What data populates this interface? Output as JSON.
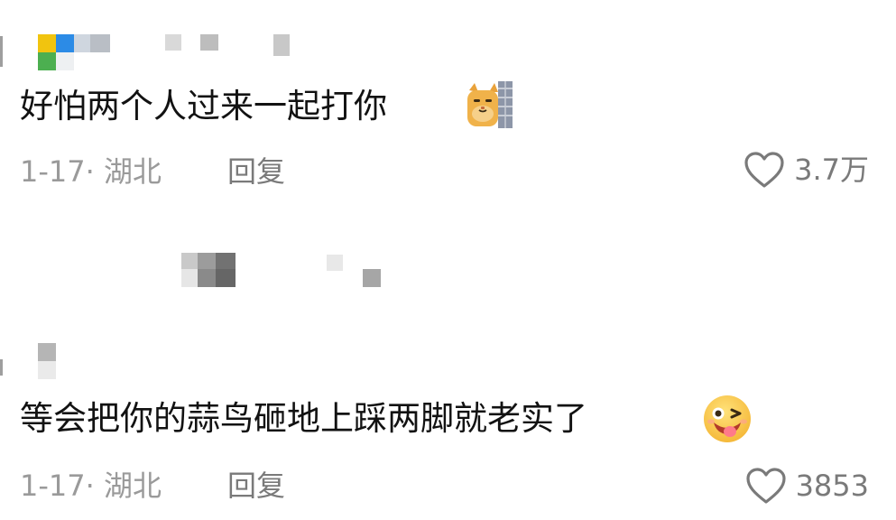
{
  "comments": [
    {
      "text": "好怕两个人过来一起打你",
      "emoji": "cat-emoji-icon",
      "date": "1-17·",
      "location": "湖北",
      "reply_label": "回复",
      "likes": "3.7万"
    },
    {
      "text": "等会把你的蒜鸟砸地上踩两脚就老实了",
      "emoji": "wink-tongue-emoji-icon",
      "date": "1-17·",
      "location": "湖北",
      "reply_label": "回复",
      "likes": "3853"
    }
  ],
  "colors": {
    "text": "#121212",
    "meta": "#9a9a9a",
    "like": "#7a7a7a",
    "background": "#ffffff"
  }
}
